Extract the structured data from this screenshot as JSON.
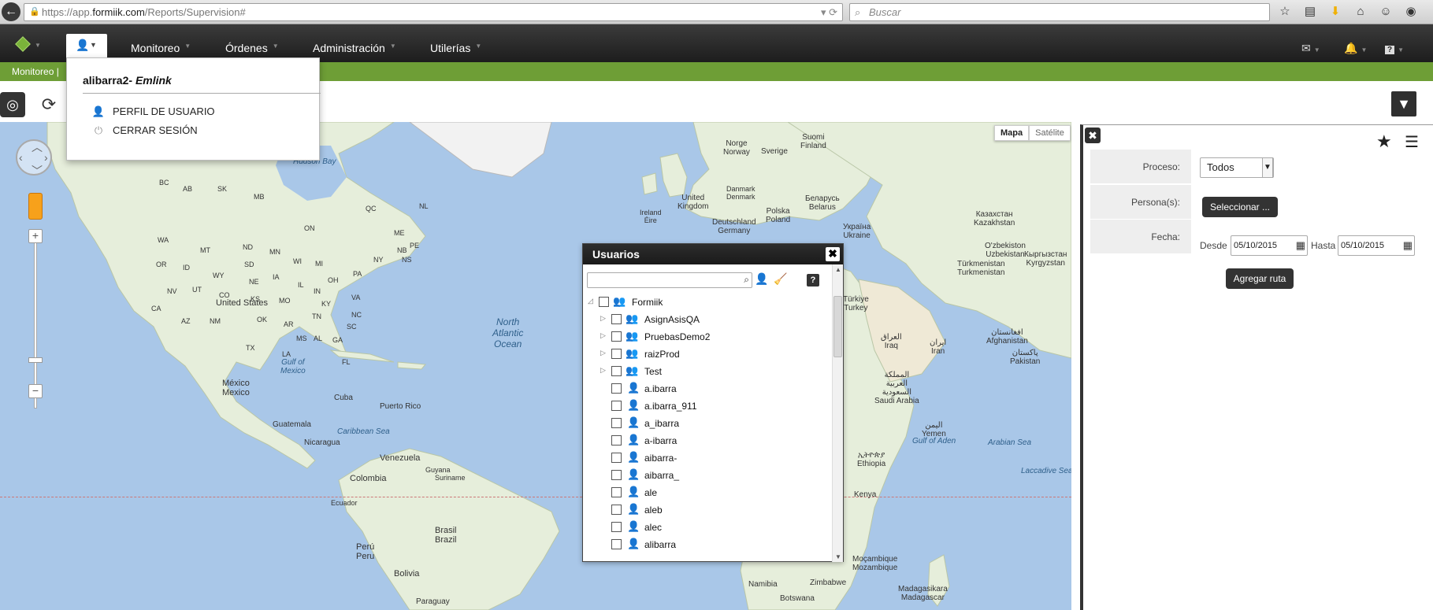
{
  "browser": {
    "url_prefix": "https://app.",
    "url_host": "formiik.com",
    "url_path": "/Reports/Supervision#",
    "search_placeholder": "Buscar"
  },
  "nav": {
    "items": [
      {
        "label": "Monitoreo"
      },
      {
        "label": "Órdenes"
      },
      {
        "label": "Administración"
      },
      {
        "label": "Utilerías"
      }
    ]
  },
  "breadcrumb": {
    "current": "Monitoreo |"
  },
  "user_menu": {
    "user": "alibarra2-",
    "company": "Emlink",
    "items": [
      {
        "label": "PERFIL DE USUARIO",
        "icon": "user-icon"
      },
      {
        "label": "CERRAR SESIÓN",
        "icon": "power-icon"
      }
    ]
  },
  "map": {
    "type_map": "Mapa",
    "type_satellite": "Satélite",
    "labels": {
      "suomi": "Suomi\nFinland",
      "norge": "Norge\nNorway",
      "sverige": "Sverige",
      "hudson_bay": "Hudson Bay",
      "ireland": "Ireland\nÉire",
      "uk": "United\nKingdom",
      "denmark": "Danmark\nDenmark",
      "deutschland": "Deutschland\nGermany",
      "polska": "Polska\nPoland",
      "belarus": "Беларусь\nBelarus",
      "ukraina": "Україна\nUkraine",
      "kazakhstan": "Казахстан\nKazakhstan",
      "uzbekistan": "O'zbekiston\nUzbekistan",
      "kyrgyzstan": "Кыргызстан\nKyrgyzstan",
      "turkmenistan": "Türkmenistan\nTurkmenistan",
      "turkiye": "Türkiye\nTurkey",
      "iraq": "العراق\nIraq",
      "iran": "ایران\nIran",
      "afghanistan": "افغانستان\nAfghanistan",
      "pakistan": "پاکستان\nPakistan",
      "saudi": "المملكة\nالعربية\nالسعودية\nSaudi Arabia",
      "yemen": "اليمن\nYemen",
      "gulf_aden": "Gulf of Aden",
      "arabian_sea": "Arabian Sea",
      "ethiopia": "ኢትዮጵያ\nEthiopia",
      "kenya": "Kenya",
      "laccadive": "Laccadive Sea",
      "mozambique": "Moçambique\nMozambique",
      "madagasikara": "Madagasikara\nMadagascar",
      "namibia": "Namibia",
      "zimbabwe": "Zimbabwe",
      "botswana": "Botswana",
      "north_atlantic": "North\nAtlantic\nOcean",
      "united_states": "United States",
      "mexico": "México\nMexico",
      "gulf_mexico": "Gulf of\nMexico",
      "cuba": "Cuba",
      "puerto_rico": "Puerto Rico",
      "guatemala": "Guatemala",
      "caribbean": "Caribbean Sea",
      "nicaragua": "Nicaragua",
      "venezuela": "Venezuela",
      "colombia": "Colombia",
      "guyana": "Guyana",
      "suriname": "Suriname",
      "ecuador": "Ecuador",
      "brasil": "Brasil\nBrazil",
      "peru": "Perú\nPeru",
      "bolivia": "Bolivia",
      "paraguay": "Paraguay",
      "ab": "AB",
      "sk": "SK",
      "mb": "MB",
      "on": "ON",
      "qc": "QC",
      "nl": "NL",
      "nb": "NB",
      "ns": "NS",
      "pe": "PE",
      "wa": "WA",
      "mt": "MT",
      "nd": "ND",
      "mn": "MN",
      "or": "OR",
      "id": "ID",
      "wy": "WY",
      "sd": "SD",
      "ia": "IA",
      "wi": "WI",
      "mi": "MI",
      "ny": "NY",
      "me": "ME",
      "nv": "NV",
      "ut": "UT",
      "co": "CO",
      "ne": "NE",
      "ks": "KS",
      "mo": "MO",
      "il": "IL",
      "in": "IN",
      "oh": "OH",
      "pa": "PA",
      "ca": "CA",
      "az": "AZ",
      "nm": "NM",
      "ok": "OK",
      "ar": "AR",
      "tn": "TN",
      "ky": "KY",
      "va": "VA",
      "nc": "NC",
      "sc": "SC",
      "ms": "MS",
      "al": "AL",
      "ga": "GA",
      "la": "LA",
      "tx": "TX",
      "fl": "FL",
      "bc": "BC"
    }
  },
  "users_panel": {
    "title": "Usuarios",
    "root": "Formiik",
    "groups": [
      "AsignAsisQA",
      "PruebasDemo2",
      "raizProd",
      "Test"
    ],
    "users": [
      "a.ibarra",
      "a.ibarra_911",
      "a_ibarra",
      "a-ibarra",
      "aibarra-",
      "aibarra_",
      "ale",
      "aleb",
      "alec",
      "alibarra"
    ]
  },
  "filter": {
    "proceso_label": "Proceso:",
    "proceso_value": "Todos",
    "persona_label": "Persona(s):",
    "persona_button": "Seleccionar ...",
    "fecha_label": "Fecha:",
    "desde_label": "Desde",
    "desde_value": "05/10/2015",
    "hasta_label": "Hasta",
    "hasta_value": "05/10/2015",
    "add_route_button": "Agregar ruta"
  },
  "colors": {
    "nav_dark": "#1d1d1d",
    "accent_green": "#6e9e36",
    "water": "#a9c7e8",
    "land": "#e6eedb"
  }
}
